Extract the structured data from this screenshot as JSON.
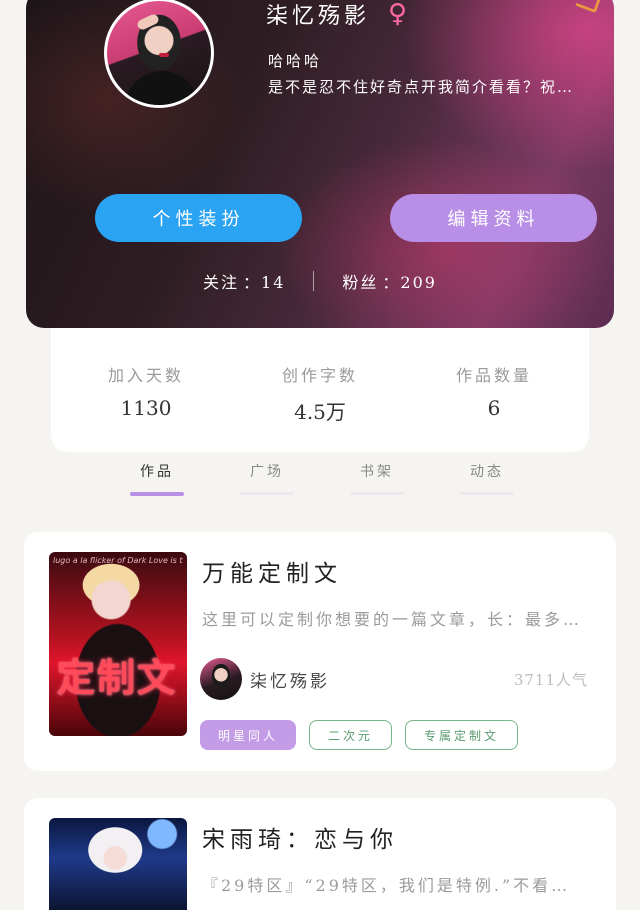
{
  "profile": {
    "nickname": "柒忆殇影",
    "gender_icon": "♀",
    "gender": "female-icon",
    "bio_title": "哈哈哈",
    "bio_text": "是不是忍不住好奇点开我简介看看？祝…",
    "buttons": {
      "dress_up": "个性装扮",
      "edit_profile": "编辑资料"
    },
    "follow": {
      "label": "关注",
      "value": "：14"
    },
    "fans": {
      "label": "粉丝",
      "value": "：209"
    },
    "colors": {
      "dress_button": "#2aa3f3",
      "edit_button": "#b88ee6",
      "gender": "#ff6aa4"
    }
  },
  "stats": [
    {
      "label": "加入天数",
      "value": "1130"
    },
    {
      "label": "创作字数",
      "value": "4.5万"
    },
    {
      "label": "作品数量",
      "value": "6"
    }
  ],
  "tabs": [
    {
      "label": "作品",
      "active": true
    },
    {
      "label": "广场",
      "active": false
    },
    {
      "label": "书架",
      "active": false
    },
    {
      "label": "动态",
      "active": false
    }
  ],
  "works": [
    {
      "title": "万能定制文",
      "description": "这里可以定制你想要的一篇文章，长：最多…",
      "cover_text": "定制文",
      "cover_script": "lugo a la flicker of Dark Love is the Lover",
      "author": "柒忆殇影",
      "popularity": "3711人气",
      "tags": [
        "明星同人",
        "二次元",
        "专属定制文"
      ]
    },
    {
      "title": "宋雨琦：恋与你",
      "description": "『29特区』“29特区，我们是特例.”不看…"
    }
  ]
}
